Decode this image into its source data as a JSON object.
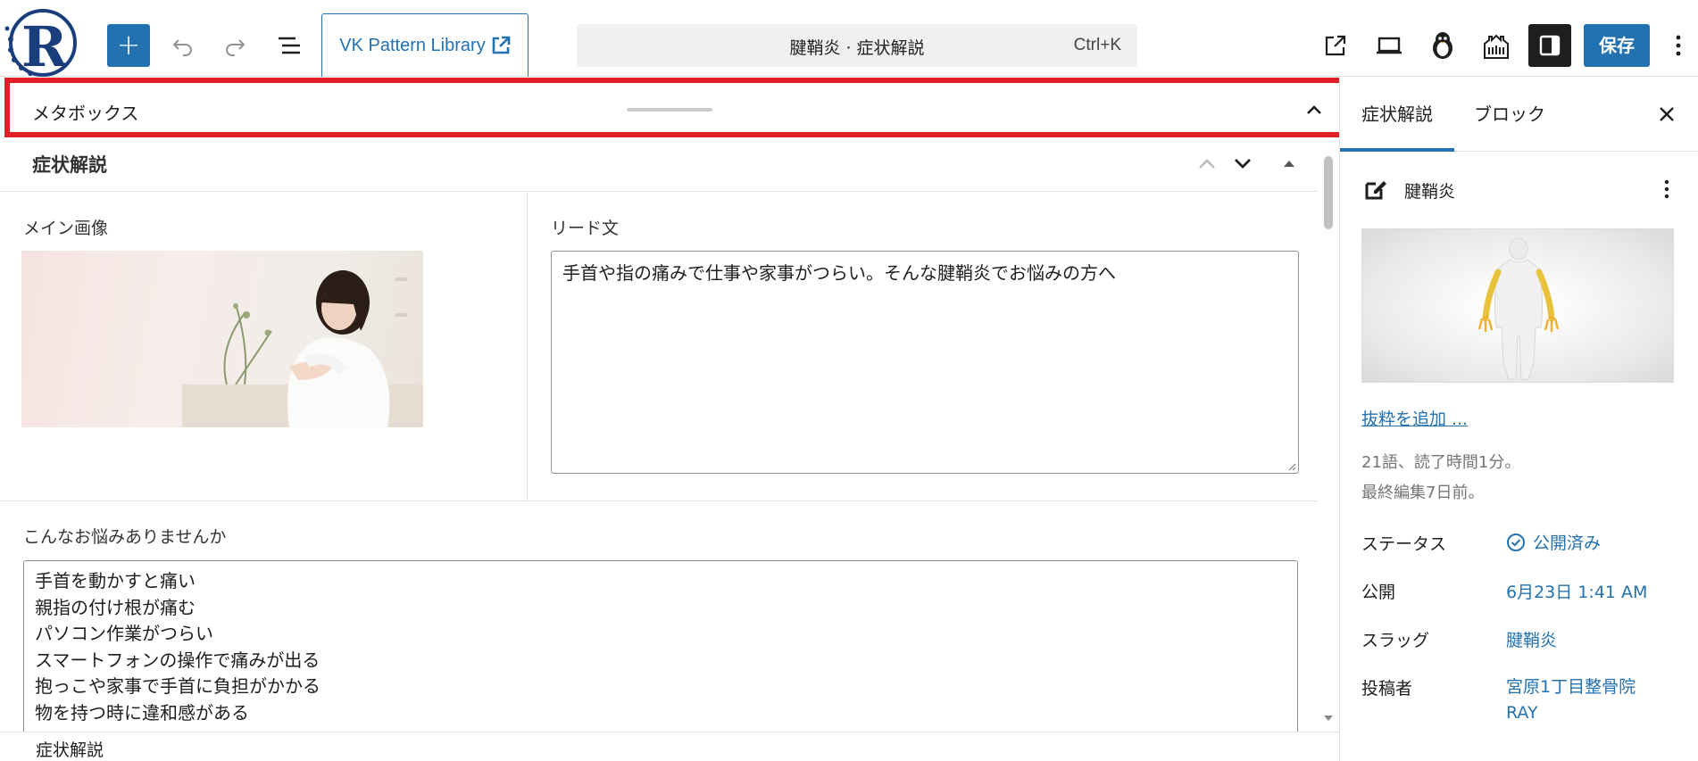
{
  "toolbar": {
    "vk_label": "VK Pattern Library",
    "doc_title": "腱鞘炎 · 症状解説",
    "shortcut": "Ctrl+K",
    "save_label": "保存",
    "icons": [
      "plus-icon",
      "undo-icon",
      "redo-icon",
      "list-view-icon",
      "external-link-icon",
      "view-icon",
      "penguin-icon",
      "building-icon",
      "sidebar-toggle-icon",
      "more-vertical-icon"
    ]
  },
  "metabox": {
    "label": "メタボックス"
  },
  "section": {
    "title": "症状解説",
    "main_image_label": "メイン画像",
    "lead_label": "リード文",
    "lead_text": "手首や指の痛みで仕事や家事がつらい。そんな腱鞘炎でお悩みの方へ",
    "worries_label": "こんなお悩みありませんか",
    "worries_lines": [
      "手首を動かすと痛い",
      "親指の付け根が痛む",
      "パソコン作業がつらい",
      "スマートフォンの操作で痛みが出る",
      "抱っこや家事で手首に負担がかかる",
      "物を持つ時に違和感がある"
    ]
  },
  "footer": {
    "label": "症状解説"
  },
  "sidebar": {
    "tabs": [
      "症状解説",
      "ブロック"
    ],
    "post_title": "腱鞘炎",
    "excerpt_link": "抜粋を追加 ...",
    "word_count": "21語、読了時間1分。",
    "last_edited": "最終編集7日前。",
    "rows": [
      {
        "label": "ステータス",
        "value": "公開済み"
      },
      {
        "label": "公開",
        "value": "6月23日 1:41 AM"
      },
      {
        "label": "スラッグ",
        "value": "腱鞘炎"
      },
      {
        "label": "投稿者",
        "value": "宮原1丁目整骨院 RAY"
      }
    ]
  },
  "colors": {
    "accent": "#2271b1",
    "highlight": "#e01f26",
    "dark": "#1e1e1e"
  }
}
